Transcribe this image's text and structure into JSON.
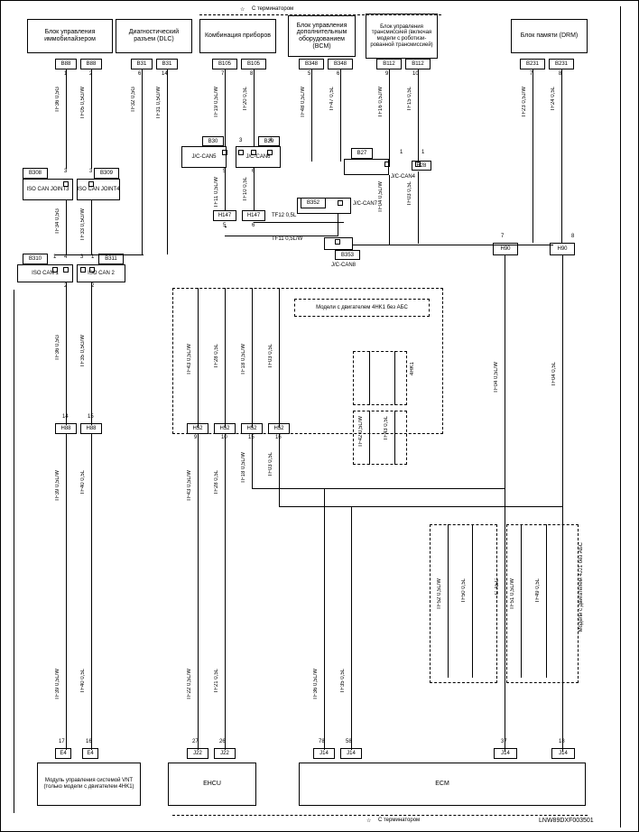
{
  "header": {
    "title_top": "С терминатором"
  },
  "footer": {
    "title_bottom": "С терминатором",
    "doc_id": "LNW89DXF003501"
  },
  "blocks": {
    "immobilizer": "Блок управления иммобилайзером",
    "connector": "Диагностический разъем (DLC)",
    "instrument": "Комбинация приборов",
    "bcm": "Блок управления дополнительным оборудованием (BCM)",
    "tcm": "Блок управления трансмиссией (включая модели с роботизи­рованной транс­миссией)",
    "drm": "Блок памяти (DRM)",
    "iso_can_joint3": "ISO CAN JOINT3",
    "iso_can_joint4": "ISO CAN JOINT4",
    "iso_can1": "ISO CAN 1",
    "iso_can2": "ISO CAN 2",
    "jc_can5": "J/C-CAN5",
    "jc_can6": "J/C-CAN6",
    "jc_can7": "J/C-CAN7",
    "jc_can4": "J/C-CAN4",
    "jc_can8": "J/C-CAN8",
    "vnt": "Модуль управления системой VNT (только модели с двигателем 4HK1)",
    "ehcu": "EHCU",
    "ecm": "ECM",
    "abs_note1": "Модели с двигателем 4HK1 без АБС",
    "abs_note2": "Модели с двигателем 4JJ1 без АБС",
    "abs4hk1": "4HK1",
    "c_abs": "С АБС"
  },
  "connectors": {
    "b88a": "B88",
    "b88b": "B88",
    "b31a": "B31",
    "b31b": "B31",
    "b105a": "B105",
    "b105b": "B105",
    "b348a": "B348",
    "b348b": "B348",
    "b112a": "B112",
    "b112b": "B112",
    "b231a": "B231",
    "b231b": "B231",
    "b308": "B308",
    "b309": "B309",
    "b310": "B310",
    "b311": "B311",
    "b30": "B30",
    "b29": "B29",
    "b27": "B27",
    "b28": "B28",
    "b352": "B352",
    "b353": "B353",
    "h147a": "H147",
    "h147b": "H147",
    "h88a": "H88",
    "h88b": "H88",
    "h52a": "H52",
    "h52b": "H52",
    "h52c": "H52",
    "h52d": "H52",
    "h90a": "H90",
    "h90b": "H90",
    "e4a": "E4",
    "e4b": "E4",
    "j22a": "J22",
    "j22b": "J22",
    "j14a": "J14",
    "j14b": "J14",
    "j14c": "J14",
    "j14d": "J14"
  },
  "wires": {
    "tf36_05g": "TF36  0,5G",
    "tf05_05gw": "TF05  0,5G/W",
    "tf32_05g": "TF32  0,5G",
    "tf31_05gw": "TF31  0,5G/W",
    "tf19_05lw": "TF19  0,5L/W",
    "tf20_05l": "TF20  0,5L",
    "tf48_05lw": "TF48  0,5L/W",
    "tf47_05l": "TF47  0,5L",
    "tf16_05jw": "TF16  0,5J/W",
    "tf15_05l": "TF15  0,5L",
    "tf23_05jw": "TF23  0,5J/W",
    "tf24_05l": "TF24  0,5L",
    "tf34_05g": "TF34  0,5G",
    "tf33_05gw": "TF33  0,5G/W",
    "tf11_05lw": "TF11  0,5L/W",
    "tf10_05l": "TF10  0,5L",
    "tf04_05lw": "TF04  0,5L/W",
    "tf03_05l": "TF03  0,5L",
    "tf12_05l": "TF12  0,5L",
    "tf11_05lw2": "TF11  0,5L/W",
    "tf36_05g2": "TF36  0,5G",
    "tf35_05gw": "TF35  0,5G/W",
    "tf43_05lw": "TF43  0,5L/W",
    "tf28_05l": "TF28  0,5L",
    "tf18_05lw": "TF18  0,5L/W",
    "tf03_05l2": "TF03  0,5L",
    "tf42_05lw": "TF42  0,5L/W",
    "tf43_05l": "TF43  0,5L",
    "tf04_05l": "TF04  0,5L",
    "tf39_05lw": "TF39  0,5L/W",
    "tf40_05l": "TF40  0,5L",
    "tf43_05lw2": "TF43  0,5L/W",
    "tf28_05l2": "TF28  0,5L",
    "tf18_05lw2": "TF18  0,5L/W",
    "tf03_05l3": "TF03  0,5L",
    "tf22_05lw": "TF22  0,5L/W",
    "tf21_05l": "TF21  0,5L",
    "tf36_05lw": "TF36  0,5L/W",
    "tf35_05l": "TF35  0,5L",
    "tf52_05lw": "TF52  0,5L/W",
    "tf50_05l": "TF50  0,5L",
    "tf51_05lw": "TF51  0,5L/W",
    "tf49_05l": "TF49  0,5L",
    "tf39_05l": "TF39  0,5L"
  },
  "pins": {
    "p1": "1",
    "p2": "2",
    "p3": "3",
    "p4": "4",
    "p5": "5",
    "p6": "6",
    "p7": "7",
    "p8": "8",
    "p9": "9",
    "p10": "10",
    "p14": "14",
    "p15": "15",
    "p16": "16",
    "p17": "17",
    "p18": "18",
    "p26": "26",
    "p27": "27",
    "p37": "37",
    "p58": "58",
    "p78": "78"
  }
}
